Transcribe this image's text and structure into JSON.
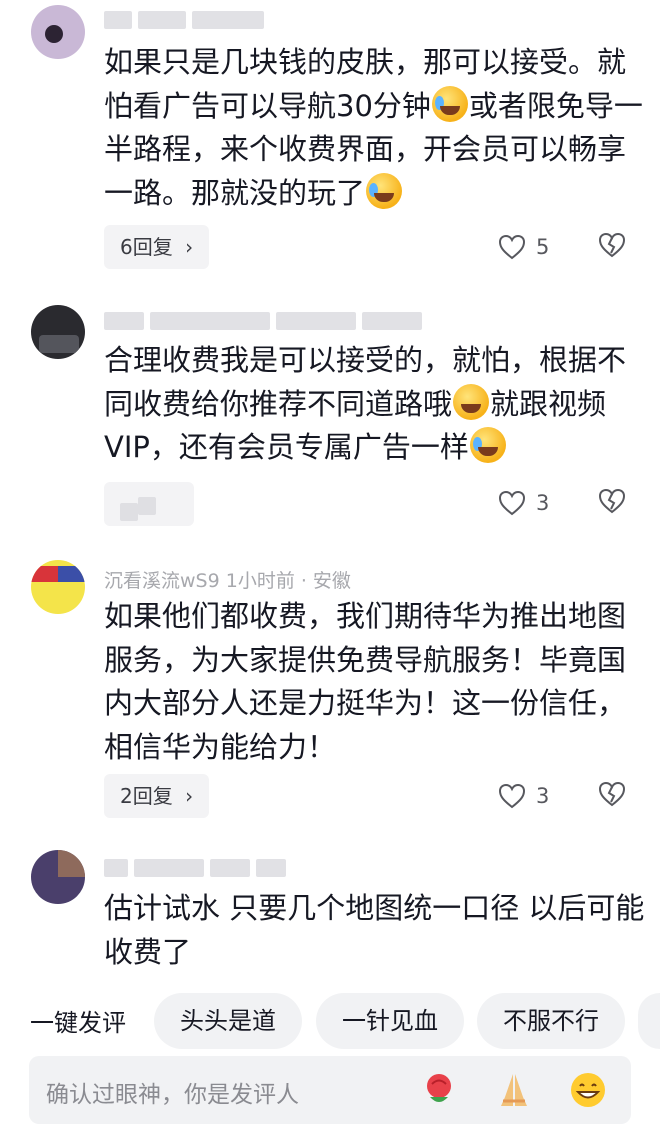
{
  "comments": [
    {
      "text_a": "如果只是几块钱的皮肤，那可以接受。就怕看广告可以导航30分钟",
      "text_b": "或者限免导一半路程，来个收费界面，开会员可以畅享一路。那就没的玩了",
      "reply_label": "6回复",
      "likes": "5"
    },
    {
      "text_a": "合理收费我是可以接受的，就怕，根据不同收费给你推荐不同道路哦",
      "text_b": "就跟视频VIP，还有会员专属广告一样",
      "likes": "3"
    },
    {
      "meta": "沉看溪流wS9  1小时前 · 安徽",
      "text": "如果他们都收费，我们期待华为推出地图服务，为大家提供免费导航服务！毕竟国内大部分人还是力挺华为！这一份信任，相信华为能给力！",
      "reply_label": "2回复",
      "likes": "3"
    },
    {
      "text": "估计试水 只要几个地图统一口径 以后可能收费了"
    }
  ],
  "quick_comment": {
    "label": "一键发评",
    "chips": [
      "头头是道",
      "一针见血",
      "不服不行"
    ]
  },
  "input": {
    "placeholder": "确认过眼神，你是发评人"
  },
  "icons": {
    "like": "heart-outline-icon",
    "dislike": "broken-heart-icon",
    "chevron": "chevron-right-icon",
    "input_buttons": [
      "rose-emoji-icon",
      "pray-emoji-icon",
      "grin-emoji-icon"
    ]
  }
}
